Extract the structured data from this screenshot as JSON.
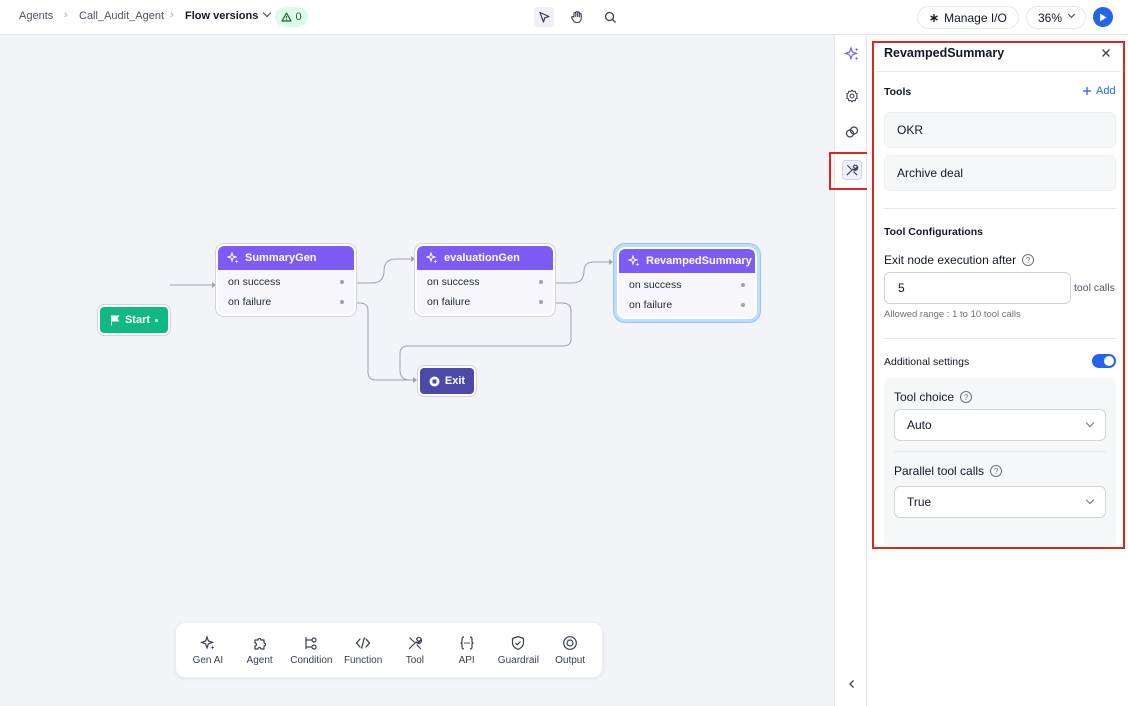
{
  "breadcrumb": {
    "items": [
      "Agents",
      "Call_Audit_Agent"
    ],
    "current": "Flow versions",
    "warning_count": "0"
  },
  "header": {
    "manage_io": "Manage I/O",
    "zoom": "36%"
  },
  "canvas": {
    "start_label": "Start",
    "nodes": [
      {
        "title": "SummaryGen",
        "outputs": [
          "on success",
          "on failure"
        ]
      },
      {
        "title": "evaluationGen",
        "outputs": [
          "on success",
          "on failure"
        ]
      },
      {
        "title": "RevampedSummary",
        "outputs": [
          "on success",
          "on failure"
        ]
      }
    ],
    "exit_label": "Exit"
  },
  "palette": [
    {
      "label": "Gen AI",
      "icon": "sparkle-icon"
    },
    {
      "label": "Agent",
      "icon": "puzzle-icon"
    },
    {
      "label": "Condition",
      "icon": "branch-icon"
    },
    {
      "label": "Function",
      "icon": "code-icon"
    },
    {
      "label": "Tool",
      "icon": "wrench-icon"
    },
    {
      "label": "API",
      "icon": "braces-icon"
    },
    {
      "label": "Guardrail",
      "icon": "shield-icon"
    },
    {
      "label": "Output",
      "icon": "target-icon"
    }
  ],
  "panel": {
    "title": "RevampedSummary",
    "tools_heading": "Tools",
    "add_label": "Add",
    "tools": [
      "OKR",
      "Archive deal"
    ],
    "config_heading": "Tool Configurations",
    "exit_label": "Exit node execution after",
    "exit_value": "5",
    "exit_suffix": "tool calls",
    "exit_hint": "Allowed range : 1 to 10 tool calls",
    "additional_heading": "Additional settings",
    "additional_enabled": true,
    "tool_choice_label": "Tool choice",
    "tool_choice_value": "Auto",
    "parallel_label": "Parallel tool calls",
    "parallel_value": "True"
  },
  "colors": {
    "accent": "#2563eb",
    "node_header": "#7c5cf5",
    "start": "#10b981",
    "exit": "#4b4aa8",
    "highlight": "#dc2626"
  }
}
